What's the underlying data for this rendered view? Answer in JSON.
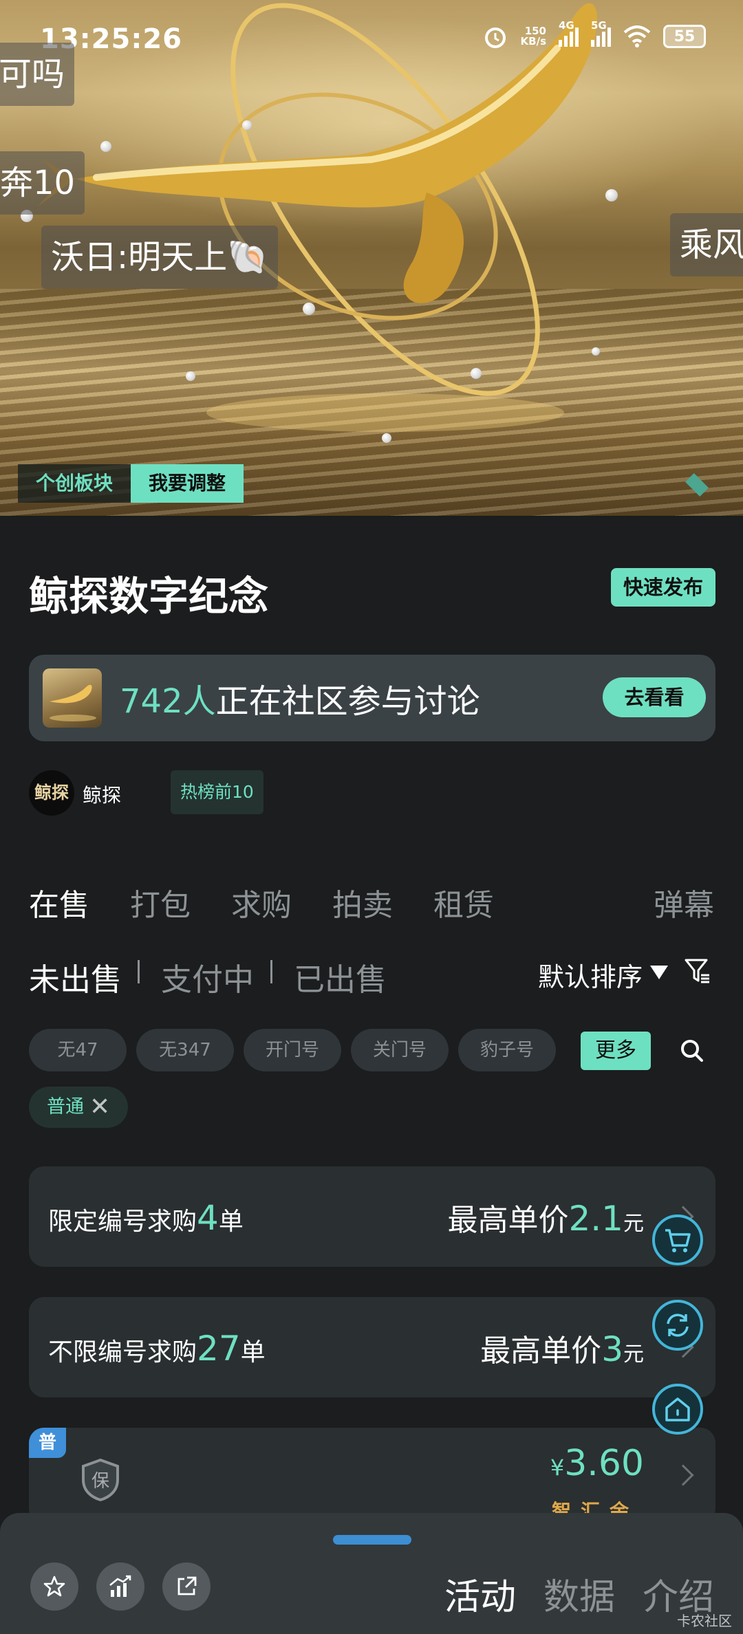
{
  "status_bar": {
    "time": "13:25:26",
    "net_speed_value": "150",
    "net_speed_unit": "KB/s",
    "sim1": "4G",
    "sim2": "5G",
    "battery": "55"
  },
  "hero": {
    "danmu": [
      "可吗",
      "奔10",
      "沃日:明天上🐚",
      "乘风"
    ],
    "tag_section": "个创板块",
    "tag_adjust": "我要调整"
  },
  "header": {
    "title": "鲸探数字纪念",
    "quick_publish": "快速发布"
  },
  "discussion": {
    "count": "742人",
    "text": "正在社区参与讨论",
    "button": "去看看"
  },
  "author": {
    "avatar_text": "鲸探",
    "name": "鲸探",
    "badge": "热榜前10"
  },
  "tabs": [
    "在售",
    "打包",
    "求购",
    "拍卖",
    "租赁"
  ],
  "danmu_toggle": "弹幕",
  "sub_tabs": [
    "未出售",
    "支付中",
    "已出售"
  ],
  "sort_label": "默认排序",
  "chips": [
    "无47",
    "无347",
    "开门号",
    "关门号",
    "豹子号"
  ],
  "more_label": "更多",
  "active_filter": "普通",
  "requests": [
    {
      "prefix": "限定编号求购",
      "count": "4",
      "suffix": "单",
      "price_label": "最高单价",
      "price": "2.1",
      "unit": "元"
    },
    {
      "prefix": "不限编号求购",
      "count": "27",
      "suffix": "单",
      "price_label": "最高单价",
      "price": "3",
      "unit": "元"
    }
  ],
  "listing": {
    "badge": "普",
    "shield_text": "保",
    "currency": "¥",
    "price": "3.60",
    "seller_label": "智汇余"
  },
  "bottom": {
    "tabs": [
      "活动",
      "数据",
      "介绍"
    ],
    "active_tab": "活动",
    "watermark": "卡农社区"
  },
  "colors": {
    "accent": "#6ee0c2",
    "background": "#1b1d1e",
    "card": "#2a2f31",
    "fab_ring": "#43b6d9",
    "pu_badge": "#3f8fd9",
    "seller_label": "#e0a94a"
  }
}
